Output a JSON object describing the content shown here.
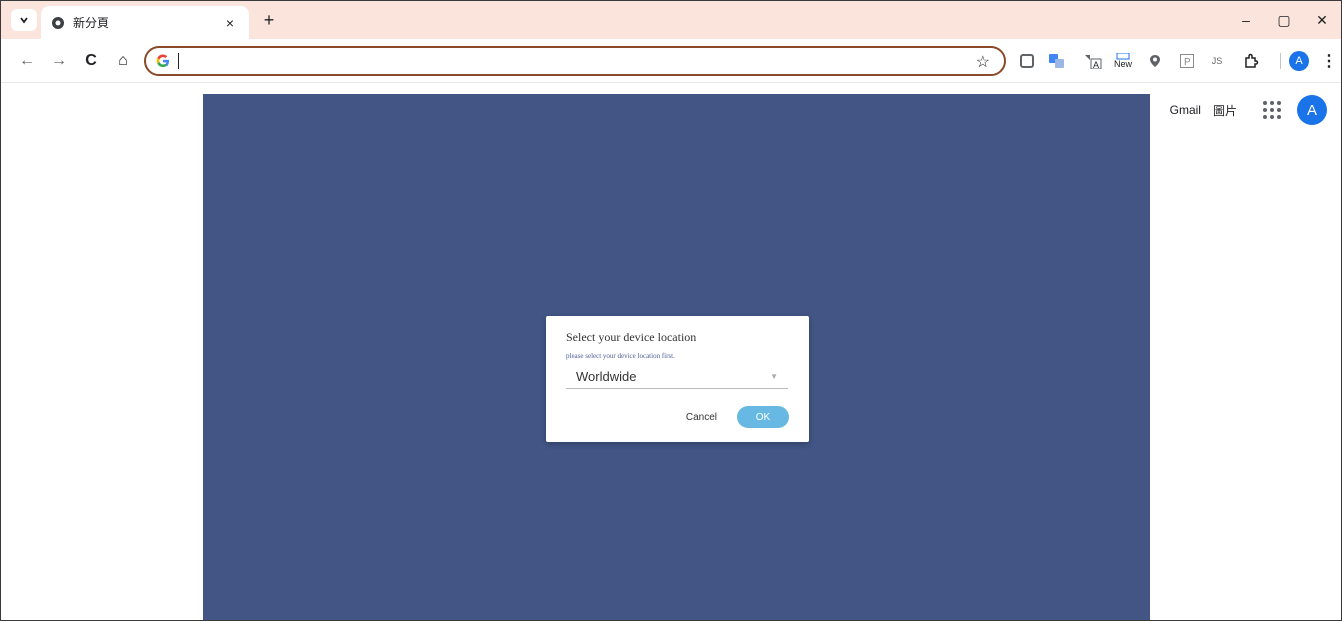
{
  "browser": {
    "tab_title": "新分頁",
    "tab_close": "×",
    "new_tab": "+",
    "win_minimize": "–",
    "win_maximize": "▢",
    "win_close": "✕",
    "omnibox_value": "",
    "profile_initial": "A"
  },
  "toolbar": {
    "back": "←",
    "forward": "→",
    "reload": "C",
    "home": "⌂",
    "star": "☆",
    "ext_new_label": "New",
    "ext_js_label": "JS"
  },
  "gbar": {
    "gmail": "Gmail",
    "images": "圖片",
    "avatar_initial": "A"
  },
  "overlay": {
    "color": "#425585"
  },
  "dialog": {
    "title": "Select your device location",
    "subtitle": "please select your device location first.",
    "selected_location": "Worldwide",
    "cancel_label": "Cancel",
    "ok_label": "OK",
    "ok_color": "#67b9e3"
  }
}
